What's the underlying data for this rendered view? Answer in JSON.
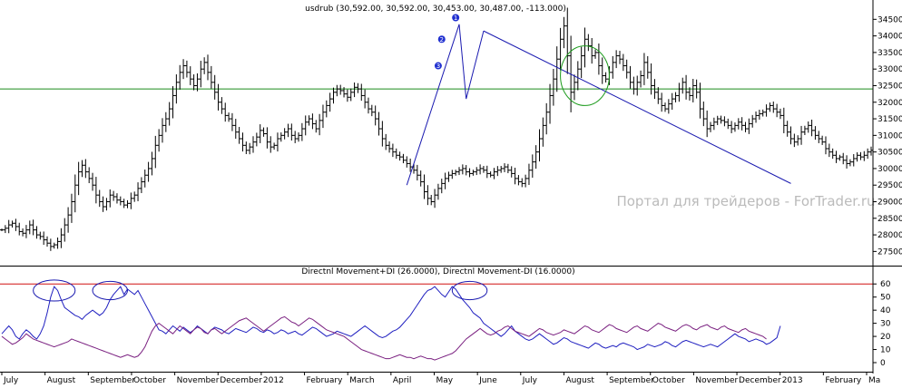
{
  "colors": {
    "price_bars": "#000000",
    "plus_di": "#2020c0",
    "minus_di": "#7a2080",
    "hline_price": "#1a8a1a",
    "hline_indicator": "#d01010",
    "trendline": "#1a1ab0",
    "circle_green": "#1a9a1a",
    "circle_blue": "#1a1ab0",
    "watermark": "#bbbbbb",
    "wave_marker": "#2030d0"
  },
  "watermark": "Портал для трейдеров - ForTrader.ru",
  "chart_data": [
    {
      "type": "ohlc",
      "title": "usdrub (30,592.00, 30,592.00, 30,453.00, 30,487.00, -113.000)",
      "ylim": [
        27100,
        34700
      ],
      "y_ticks": [
        "34500",
        "34000",
        "33500",
        "33000",
        "32500",
        "32000",
        "31500",
        "31000",
        "30500",
        "30000",
        "29500",
        "29000",
        "28500",
        "28000",
        "27500"
      ],
      "x_ticks": [
        "July",
        "August",
        "September",
        "October",
        "November",
        "December",
        "2012",
        "February",
        "March",
        "April",
        "May",
        "June",
        "July",
        "August",
        "September",
        "October",
        "November",
        "December",
        "2013",
        "February",
        "Ma"
      ],
      "horizontal_line": 32400,
      "wave_labels": [
        {
          "label": "3",
          "x": 125,
          "y": 33100
        },
        {
          "label": "2",
          "x": 126,
          "y": 33900
        },
        {
          "label": "1",
          "x": 130,
          "y": 34550
        }
      ],
      "trendline": [
        {
          "x": 138,
          "y": 34150
        },
        {
          "x": 226,
          "y": 29550
        }
      ],
      "wedge_line": [
        {
          "x": 116,
          "y": 29500
        },
        {
          "x": 131,
          "y": 34350
        },
        {
          "x": 133,
          "y": 32100
        },
        {
          "x": 138,
          "y": 34150
        }
      ],
      "circle_annotation": {
        "x": 167,
        "y": 32800,
        "radius_x_units": 7,
        "radius_y_units": 900
      },
      "close": [
        28150,
        28200,
        28300,
        28350,
        28250,
        28100,
        28050,
        28150,
        28300,
        28150,
        28000,
        27950,
        27850,
        27750,
        27650,
        27700,
        27800,
        28000,
        28300,
        28600,
        29000,
        29500,
        29900,
        30100,
        29900,
        29700,
        29500,
        29200,
        29000,
        28850,
        29000,
        29200,
        29150,
        29050,
        29000,
        28900,
        28950,
        29100,
        29200,
        29400,
        29600,
        29800,
        30000,
        30300,
        30700,
        31000,
        31300,
        31500,
        31800,
        32200,
        32600,
        32900,
        33100,
        32900,
        32700,
        32500,
        32700,
        33000,
        33200,
        32900,
        32600,
        32300,
        32000,
        31800,
        31600,
        31500,
        31300,
        31100,
        30900,
        30700,
        30550,
        30650,
        30800,
        30950,
        31150,
        31050,
        30800,
        30650,
        30700,
        30900,
        31000,
        31100,
        31200,
        31000,
        30900,
        31000,
        31200,
        31400,
        31500,
        31350,
        31200,
        31450,
        31700,
        31900,
        32100,
        32300,
        32400,
        32350,
        32250,
        32150,
        32300,
        32450,
        32400,
        32200,
        32000,
        31800,
        31700,
        31500,
        31200,
        30900,
        30700,
        30600,
        30500,
        30400,
        30350,
        30250,
        30150,
        30050,
        29950,
        29800,
        29600,
        29300,
        29100,
        29000,
        29200,
        29400,
        29550,
        29700,
        29800,
        29850,
        29900,
        29950,
        30000,
        29900,
        29850,
        29900,
        29950,
        30000,
        29950,
        29850,
        29800,
        29900,
        29950,
        30000,
        30050,
        29950,
        29850,
        29700,
        29600,
        29550,
        29700,
        29950,
        30200,
        30500,
        30900,
        31300,
        31700,
        32200,
        32700,
        33300,
        33900,
        34300,
        33400,
        32300,
        32600,
        33000,
        33400,
        33900,
        33700,
        33400,
        33500,
        33100,
        32800,
        32700,
        32900,
        33200,
        33400,
        33300,
        33100,
        32900,
        32600,
        32400,
        32600,
        32800,
        33200,
        32900,
        32500,
        32300,
        32100,
        31900,
        31800,
        31950,
        32100,
        32200,
        32400,
        32600,
        32300,
        32200,
        32500,
        32300,
        31800,
        31500,
        31200,
        31300,
        31400,
        31500,
        31450,
        31400,
        31300,
        31200,
        31300,
        31400,
        31300,
        31200,
        31350,
        31500,
        31600,
        31650,
        31700,
        31800,
        31900,
        31800,
        31700,
        31600,
        31300,
        31100,
        30900,
        30800,
        30900,
        31100,
        31200,
        31300,
        31150,
        31000,
        30900,
        30800,
        30600,
        30500,
        30400,
        30300,
        30350,
        30250,
        30150,
        30200,
        30300,
        30400,
        30350,
        30400,
        30500,
        30550
      ],
      "series": []
    },
    {
      "type": "line",
      "title": "Directnl Movement+DI (26.0000), Directnl Movement-DI (16.0000)",
      "ylim": [
        0,
        65
      ],
      "y_ticks": [
        "60",
        "50",
        "40",
        "30",
        "20",
        "10",
        "0"
      ],
      "horizontal_line": 60,
      "circle_annotations": [
        {
          "x": 15,
          "y": 55,
          "radius_x_units": 6,
          "radius_y_units": 8
        },
        {
          "x": 31,
          "y": 55,
          "radius_x_units": 5,
          "radius_y_units": 7
        },
        {
          "x": 134,
          "y": 55,
          "radius_x_units": 5,
          "radius_y_units": 7
        }
      ],
      "series": [
        {
          "name": "+DI",
          "color_key": "plus_di",
          "values": [
            22,
            25,
            28,
            25,
            20,
            18,
            22,
            25,
            23,
            20,
            18,
            22,
            28,
            38,
            50,
            58,
            55,
            48,
            42,
            40,
            38,
            36,
            35,
            33,
            36,
            38,
            40,
            38,
            36,
            38,
            42,
            48,
            52,
            55,
            58,
            52,
            56,
            54,
            52,
            55,
            50,
            45,
            40,
            35,
            30,
            25,
            24,
            22,
            25,
            28,
            26,
            24,
            27,
            25,
            23,
            25,
            28,
            26,
            24,
            22,
            25,
            27,
            26,
            25,
            23,
            22,
            24,
            26,
            25,
            24,
            23,
            25,
            27,
            26,
            24,
            23,
            25,
            24,
            22,
            23,
            25,
            24,
            22,
            23,
            24,
            22,
            21,
            23,
            25,
            27,
            26,
            24,
            22,
            20,
            21,
            22,
            24,
            23,
            22,
            21,
            20,
            22,
            24,
            26,
            28,
            26,
            24,
            22,
            20,
            19,
            20,
            22,
            24,
            25,
            27,
            30,
            33,
            36,
            40,
            44,
            48,
            52,
            55,
            56,
            58,
            55,
            52,
            50,
            54,
            58,
            56,
            52,
            48,
            45,
            42,
            38,
            36,
            34,
            30,
            28,
            26,
            24,
            22,
            20,
            22,
            25,
            28,
            24,
            22,
            20,
            18,
            17,
            18,
            20,
            22,
            20,
            18,
            16,
            14,
            15,
            17,
            19,
            18,
            16,
            15,
            14,
            13,
            12,
            11,
            13,
            15,
            14,
            12,
            11,
            12,
            13,
            12,
            14,
            15,
            14,
            13,
            12,
            10,
            11,
            12,
            14,
            13,
            12,
            13,
            14,
            16,
            15,
            13,
            12,
            14,
            16,
            17,
            16,
            15,
            14,
            13,
            12,
            13,
            14,
            13,
            12,
            14,
            16,
            18,
            20,
            22,
            20,
            19,
            18,
            16,
            17,
            18,
            17,
            16,
            14,
            15,
            17,
            19,
            28
          ]
        },
        {
          "name": "-DI",
          "color_key": "minus_di",
          "values": [
            20,
            18,
            16,
            14,
            15,
            17,
            19,
            22,
            20,
            18,
            17,
            16,
            15,
            14,
            13,
            12,
            13,
            14,
            15,
            16,
            18,
            17,
            16,
            15,
            14,
            13,
            12,
            11,
            10,
            9,
            8,
            7,
            6,
            5,
            4,
            5,
            6,
            5,
            4,
            5,
            8,
            12,
            18,
            24,
            28,
            30,
            28,
            26,
            24,
            22,
            25,
            28,
            26,
            24,
            22,
            25,
            27,
            26,
            23,
            22,
            25,
            26,
            24,
            22,
            24,
            26,
            28,
            30,
            32,
            33,
            34,
            32,
            30,
            28,
            26,
            24,
            26,
            28,
            30,
            32,
            34,
            35,
            33,
            31,
            30,
            28,
            30,
            32,
            34,
            33,
            31,
            29,
            27,
            25,
            24,
            23,
            22,
            21,
            20,
            18,
            16,
            14,
            12,
            10,
            9,
            8,
            7,
            6,
            5,
            4,
            3,
            3,
            4,
            5,
            6,
            5,
            4,
            4,
            3,
            4,
            5,
            4,
            3,
            3,
            2,
            3,
            4,
            5,
            6,
            7,
            9,
            12,
            15,
            18,
            20,
            22,
            24,
            26,
            24,
            22,
            21,
            22,
            24,
            25,
            27,
            28,
            26,
            24,
            23,
            22,
            21,
            20,
            22,
            24,
            26,
            25,
            23,
            22,
            21,
            22,
            23,
            25,
            24,
            23,
            22,
            24,
            26,
            28,
            27,
            25,
            24,
            23,
            25,
            27,
            29,
            28,
            26,
            25,
            24,
            23,
            25,
            27,
            28,
            26,
            25,
            24,
            26,
            28,
            30,
            29,
            27,
            26,
            25,
            24,
            26,
            28,
            29,
            28,
            26,
            25,
            27,
            28,
            29,
            27,
            26,
            25,
            27,
            28,
            26,
            25,
            24,
            23,
            25,
            26,
            24,
            23,
            22,
            21,
            20,
            18
          ]
        }
      ]
    }
  ]
}
